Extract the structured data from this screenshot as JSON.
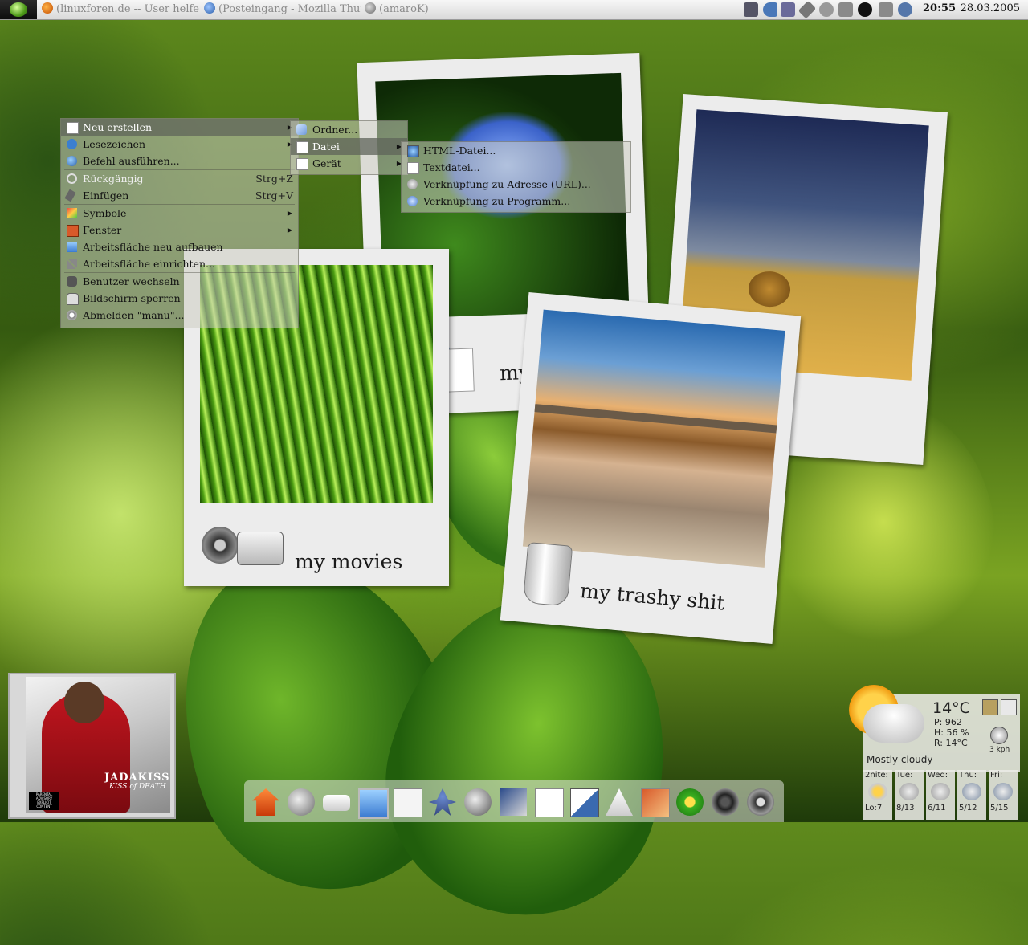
{
  "taskbar": {
    "tasks": [
      {
        "label": "(linuxforen.de -- User helfen U",
        "icon": "firefox-icon"
      },
      {
        "label": "(Posteingang - Mozilla Thund",
        "icon": "thunderbird-icon"
      },
      {
        "label": "(amaroK)",
        "icon": "amarok-icon"
      }
    ],
    "clock": "20:55",
    "date": "28.03.2005"
  },
  "desktop_menu": {
    "items": [
      {
        "label": "Neu erstellen",
        "icon": "page-icon",
        "submenu": true,
        "highlighted": true
      },
      {
        "label": "Lesezeichen",
        "icon": "heart-icon",
        "submenu": true
      },
      {
        "label": "Befehl ausführen...",
        "icon": "globe-icon"
      },
      {
        "label": "Rückgängig",
        "icon": "undo-icon",
        "shortcut": "Strg+Z",
        "disabled": true
      },
      {
        "label": "Einfügen",
        "icon": "paste-icon",
        "shortcut": "Strg+V"
      },
      {
        "label": "Symbole",
        "icon": "palette-icon",
        "submenu": true
      },
      {
        "label": "Fenster",
        "icon": "window-icon",
        "submenu": true
      },
      {
        "label": "Arbeitsfläche neu aufbauen",
        "icon": "desktop-icon"
      },
      {
        "label": "Arbeitsfläche einrichten...",
        "icon": "tools-icon"
      },
      {
        "label": "Benutzer wechseln",
        "icon": "switch-user-icon"
      },
      {
        "label": "Bildschirm sperren",
        "icon": "lock-icon"
      },
      {
        "label": "Abmelden \"manu\"...",
        "icon": "logout-icon"
      }
    ]
  },
  "submenu_new": {
    "items": [
      {
        "label": "Ordner...",
        "icon": "folder-icon"
      },
      {
        "label": "Datei",
        "icon": "page-icon",
        "submenu": true,
        "highlighted": true
      },
      {
        "label": "Gerät",
        "icon": "page-icon",
        "submenu": true
      }
    ]
  },
  "submenu_file": {
    "items": [
      {
        "label": "HTML-Datei...",
        "icon": "html-file-icon"
      },
      {
        "label": "Textdatei...",
        "icon": "text-file-icon"
      },
      {
        "label": "Verknüpfung zu Adresse (URL)...",
        "icon": "link-icon"
      },
      {
        "label": "Verknüpfung zu Programm...",
        "icon": "app-link-icon"
      }
    ]
  },
  "polaroids": {
    "movies": "my movies",
    "documents": "my documents",
    "trash": "my trashy shit"
  },
  "album": {
    "artist": "JADAKISS",
    "title": "KISS of DEATH",
    "label": "PARENTAL ADVISORY EXPLICIT CONTENT"
  },
  "weather": {
    "temp": "14°C",
    "pressure": "P:  962",
    "humidity": "H:  56 %",
    "realfeel": "R:  14°C",
    "wind": "3 kph",
    "condition": "Mostly cloudy",
    "forecast": [
      {
        "day": "2nite:",
        "temps": "Lo:7"
      },
      {
        "day": "Tue:",
        "temps": "8/13"
      },
      {
        "day": "Wed:",
        "temps": "6/11"
      },
      {
        "day": "Thu:",
        "temps": "5/12"
      },
      {
        "day": "Fri:",
        "temps": "5/15"
      }
    ]
  },
  "dock": {
    "icons": [
      "home-icon",
      "network-icon",
      "drive-icon",
      "computer-icon",
      "terminal-icon",
      "kopete-icon",
      "globe-icon",
      "thunderbird-icon",
      "office-icon",
      "editor-icon",
      "apps-icon",
      "graphics-icon",
      "bp-icon",
      "speaker-icon",
      "film-icon"
    ]
  }
}
